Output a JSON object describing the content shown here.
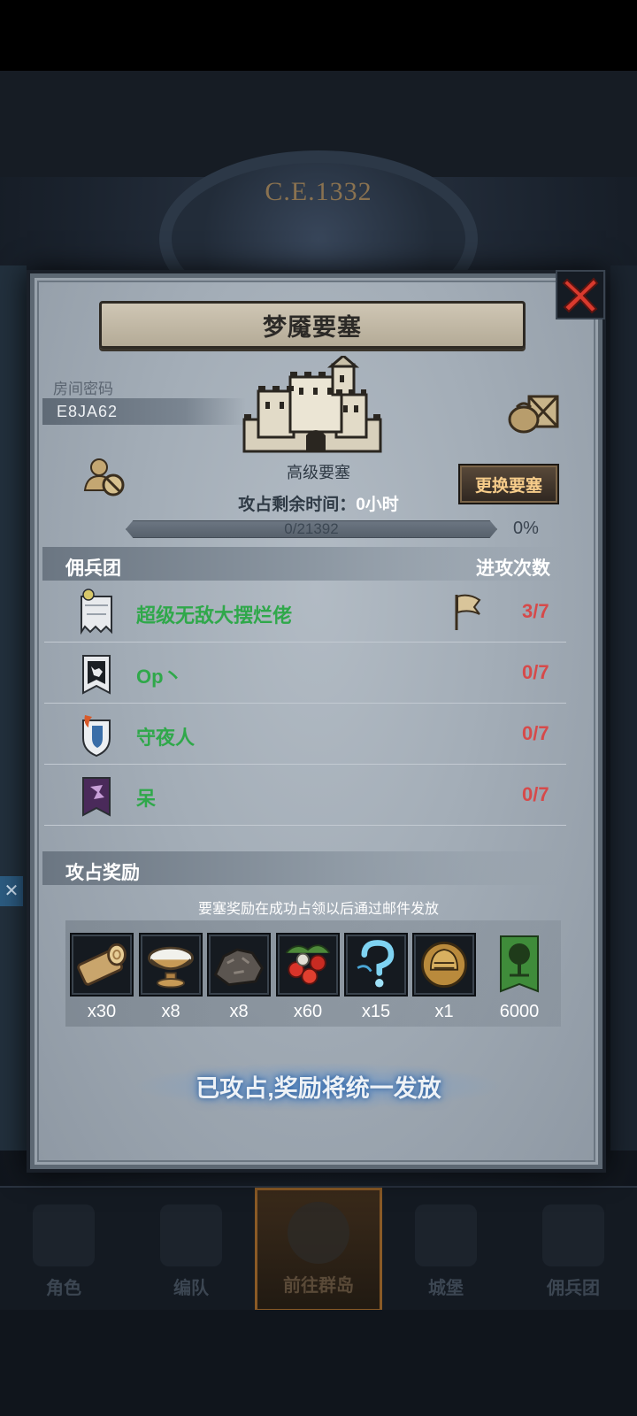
{
  "background": {
    "era": "C.E.1332"
  },
  "dialog": {
    "title": "梦魇要塞",
    "room_label": "房间密码",
    "room_code": "E8JA62",
    "fortress_level": "高级要塞",
    "change_button": "更换要塞",
    "occupy_time_label": "攻占剩余时间：",
    "occupy_time_value": "0小时",
    "progress_text": "0/21392",
    "progress_fraction": 0,
    "progress_percent": "0%",
    "guild_section_title": "佣兵团",
    "attack_count_title": "进攻次数",
    "guilds": [
      {
        "name": "超级无敌大摆烂佬",
        "count": "3/7",
        "crest": "white-banner-icon",
        "has_flag": true
      },
      {
        "name": "Op丶",
        "count": "0/7",
        "crest": "wolf-banner-icon",
        "has_flag": false
      },
      {
        "name": "守夜人",
        "count": "0/7",
        "crest": "shield-banner-icon",
        "has_flag": false
      },
      {
        "name": "呆",
        "count": "0/7",
        "crest": "purple-banner-icon",
        "has_flag": false
      }
    ],
    "reward_section_title": "攻占奖励",
    "reward_note": "要塞奖励在成功占领以后通过邮件发放",
    "rewards": [
      {
        "icon": "wood-log-icon",
        "qty": "x30"
      },
      {
        "icon": "cream-bowl-icon",
        "qty": "x8"
      },
      {
        "icon": "ore-rock-icon",
        "qty": "x8"
      },
      {
        "icon": "berries-icon",
        "qty": "x60"
      },
      {
        "icon": "mystery-question-icon",
        "qty": "x15"
      },
      {
        "icon": "knight-helmet-icon",
        "qty": "x1"
      },
      {
        "icon": "tree-banner-icon",
        "qty": "6000"
      }
    ],
    "claim_status": "已攻占,奖励将统一发放"
  },
  "bottom_nav": [
    {
      "label": "角色",
      "active": false
    },
    {
      "label": "编队",
      "active": false
    },
    {
      "label": "前往群岛",
      "active": true
    },
    {
      "label": "城堡",
      "active": false
    },
    {
      "label": "佣兵团",
      "active": false
    }
  ],
  "colors": {
    "guild_name": "#2fa84a",
    "attack_count": "#d64a4a",
    "change_button_text": "#f6cc8a",
    "close_red": "#d93a2e"
  }
}
